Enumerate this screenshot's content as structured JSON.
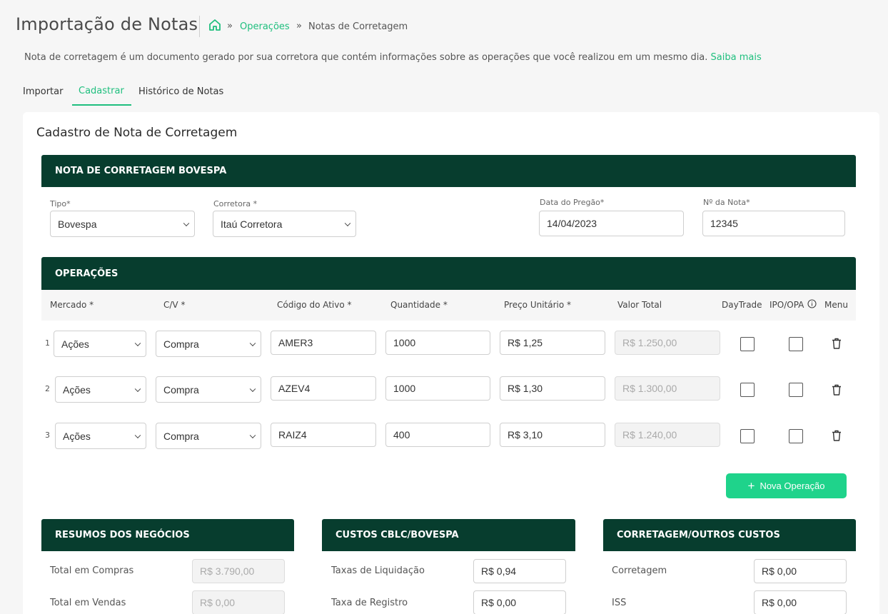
{
  "header": {
    "title": "Importação de Notas",
    "breadcrumb": {
      "sep": "»",
      "link": "Operações",
      "current": "Notas de Corretagem"
    },
    "description": "Nota de corretagem é um documento gerado por sua corretora que contém informações sobre as operações que você realizou em um mesmo dia.",
    "description_link": "Saiba mais"
  },
  "tabs": [
    {
      "label": "Importar"
    },
    {
      "label": "Cadastrar",
      "active": true
    },
    {
      "label": "Histórico de Notas"
    }
  ],
  "card_title": "Cadastro de Nota de Corretagem",
  "nota": {
    "section_title": "NOTA DE CORRETAGEM BOVESPA",
    "tipo_label": "Tipo*",
    "tipo_value": "Bovespa",
    "corretora_label": "Corretora *",
    "corretora_value": "Itaú Corretora",
    "data_label": "Data do Pregão*",
    "data_value": "14/04/2023",
    "numero_label": "Nº da Nota*",
    "numero_value": "12345"
  },
  "operacoes": {
    "section_title": "OPERAÇÕES",
    "columns": {
      "mercado": "Mercado *",
      "cv": "C/V *",
      "codigo": "Código do Ativo *",
      "quantidade": "Quantidade *",
      "preco": "Preço Unitário *",
      "valor": "Valor Total",
      "daytrade": "DayTrade",
      "ipo": "IPO/OPA",
      "menu": "Menu"
    },
    "rows": [
      {
        "num": "1",
        "mercado": "Ações",
        "cv": "Compra",
        "codigo": "AMER3",
        "quantidade": "1000",
        "preco": "R$ 1,25",
        "valor": "R$ 1.250,00"
      },
      {
        "num": "2",
        "mercado": "Ações",
        "cv": "Compra",
        "codigo": "AZEV4",
        "quantidade": "1000",
        "preco": "R$ 1,30",
        "valor": "R$ 1.300,00"
      },
      {
        "num": "3",
        "mercado": "Ações",
        "cv": "Compra",
        "codigo": "RAIZ4",
        "quantidade": "400",
        "preco": "R$ 3,10",
        "valor": "R$ 1.240,00"
      }
    ],
    "new_button": "Nova Operação"
  },
  "resumos": {
    "title": "RESUMOS DOS NEGÓCIOS",
    "items": [
      {
        "label": "Total em Compras",
        "value": "R$ 3.790,00"
      },
      {
        "label": "Total em Vendas",
        "value": "R$ 0,00"
      }
    ]
  },
  "custos": {
    "title": "CUSTOS CBLC/BOVESPA",
    "items": [
      {
        "label": "Taxas de Liquidação",
        "value": "R$ 0,94"
      },
      {
        "label": "Taxa de Registro",
        "value": "R$ 0,00"
      }
    ]
  },
  "corretagem": {
    "title": "CORRETAGEM/OUTROS CUSTOS",
    "items": [
      {
        "label": "Corretagem",
        "value": "R$ 0,00"
      },
      {
        "label": "ISS",
        "value": "R$ 0,00"
      }
    ]
  },
  "colors": {
    "accent": "#1fbf7e",
    "header_bg": "#073d2e",
    "button": "#1fd38b"
  }
}
